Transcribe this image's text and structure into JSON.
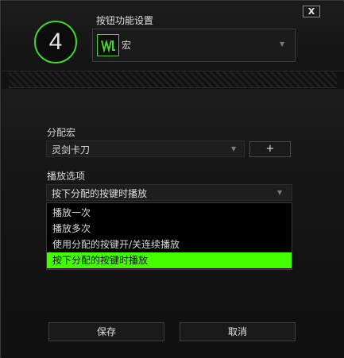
{
  "dialog": {
    "close_label": "X",
    "key_number": "4",
    "function_label": "按钮功能设置",
    "function_value": "宏",
    "function_icon": "macro-icon",
    "accent_color": "#44d62c",
    "highlight_color": "#44ff00"
  },
  "macro": {
    "label": "分配宏",
    "value": "灵剑卡刀",
    "add_label": "+"
  },
  "playback": {
    "label": "播放选项",
    "value": "按下分配的按键时播放",
    "options": [
      "播放一次",
      "播放多次",
      "使用分配的按键开/关连续播放",
      "按下分配的按键时播放"
    ],
    "selected_index": 3
  },
  "footer": {
    "save_label": "保存",
    "cancel_label": "取消"
  }
}
